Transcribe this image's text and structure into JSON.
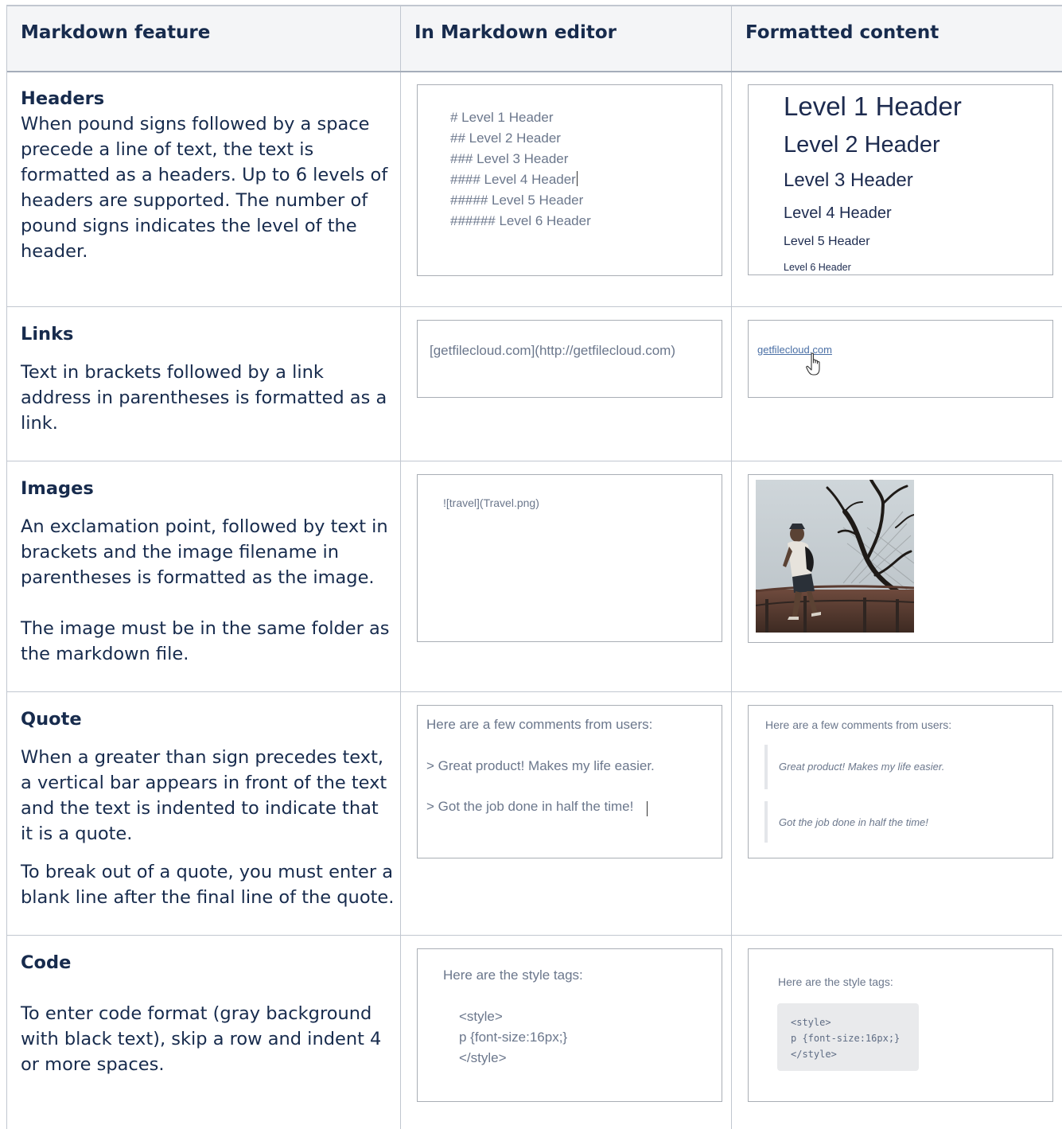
{
  "table": {
    "headers": [
      "Markdown feature",
      "In Markdown editor",
      "Formatted content"
    ],
    "rows": [
      {
        "feature": "Headers",
        "description": [
          "When pound signs followed by a space precede a line of text, the text is formatted as a headers. Up to 6 levels of headers are supported. The number of pound signs indicates the level of the header."
        ],
        "editor": [
          "# Level 1 Header",
          "## Level 2 Header",
          "### Level 3 Header",
          "#### Level 4 Header",
          "##### Level 5 Header",
          "###### Level 6 Header"
        ],
        "formatted": [
          "Level 1 Header",
          "Level 2 Header",
          "Level 3 Header",
          "Level 4 Header",
          "Level 5 Header",
          "Level 6 Header"
        ]
      },
      {
        "feature": "Links",
        "description": [
          "Text in brackets followed by a link address in parentheses is formatted as a link."
        ],
        "editor": [
          "[getfilecloud.com](http://getfilecloud.com)"
        ],
        "formatted": [
          "getfilecloud.com"
        ]
      },
      {
        "feature": "Images",
        "description": [
          "An exclamation point, followed by text in brackets and the image filename in parentheses is formatted as the image.",
          "The image must be in the same folder as the markdown file."
        ],
        "editor": [
          "![travel](Travel.png)"
        ],
        "formatted": []
      },
      {
        "feature": "Quote",
        "description": [
          "When a greater than sign precedes text, a vertical bar appears in front of the text and the text is indented to indicate that it is a quote.",
          "To break out of a quote, you must enter a blank line after the final line of the quote."
        ],
        "editor": [
          "Here are a few comments from users:",
          "> Great product! Makes my life easier.",
          "> Got the job done in half the time!"
        ],
        "formatted": [
          "Here are a few comments from users:",
          "Great product! Makes my life easier.",
          "Got the job done in half the time!"
        ]
      },
      {
        "feature": "Code",
        "description": [
          "To enter code format (gray background with black text), skip a row and indent 4 or more spaces."
        ],
        "editor": [
          "Here are the style tags:",
          "<style>",
          "p {font-size:16px;}",
          "</style>"
        ],
        "formatted": [
          "Here are the style tags:",
          "<style>\np {font-size:16px;}\n</style>"
        ]
      }
    ]
  }
}
